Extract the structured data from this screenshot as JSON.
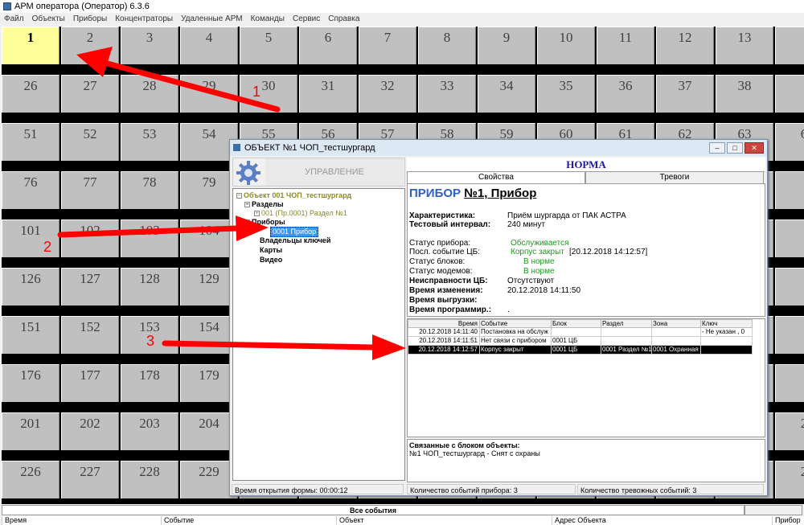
{
  "app": {
    "title": "АРМ оператора (Оператор) 6.3.6"
  },
  "menu": [
    "Файл",
    "Объекты",
    "Приборы",
    "Концентраторы",
    "Удаленные АРМ",
    "Команды",
    "Сервис",
    "Справка"
  ],
  "grid_rows": [
    [
      "1",
      "2",
      "3",
      "4",
      "5",
      "6",
      "7",
      "8",
      "9",
      "10",
      "11",
      "12",
      "13",
      ""
    ],
    [
      "26",
      "27",
      "28",
      "29",
      "30",
      "31",
      "32",
      "33",
      "34",
      "35",
      "36",
      "37",
      "38",
      ""
    ],
    [
      "51",
      "52",
      "53",
      "54",
      "55",
      "56",
      "57",
      "58",
      "59",
      "60",
      "61",
      "62",
      "63",
      "6"
    ],
    [
      "76",
      "77",
      "78",
      "79",
      "",
      "",
      "",
      "",
      "",
      "",
      "",
      "",
      "",
      ""
    ],
    [
      "101",
      "102",
      "103",
      "104",
      "",
      "",
      "",
      "",
      "",
      "",
      "",
      "",
      "",
      ""
    ],
    [
      "126",
      "127",
      "128",
      "129",
      "",
      "",
      "",
      "",
      "",
      "",
      "",
      "",
      "",
      ""
    ],
    [
      "151",
      "152",
      "153",
      "154",
      "",
      "",
      "",
      "",
      "",
      "",
      "",
      "",
      "",
      ""
    ],
    [
      "176",
      "177",
      "178",
      "179",
      "",
      "",
      "",
      "",
      "",
      "",
      "",
      "",
      "",
      ""
    ],
    [
      "201",
      "202",
      "203",
      "204",
      "",
      "",
      "",
      "",
      "",
      "",
      "",
      "",
      "",
      "2"
    ],
    [
      "226",
      "227",
      "228",
      "229",
      "",
      "",
      "",
      "",
      "",
      "",
      "",
      "",
      "",
      "2"
    ]
  ],
  "dialog": {
    "title": "ОБЪЕКТ №1 ЧОП_тестшургард",
    "management_label": "УПРАВЛЕНИЕ",
    "state": "НОРМА",
    "tabs": [
      "Свойства",
      "Тревоги"
    ],
    "tree": {
      "root": "Объект 001 ЧОП_тестшургард",
      "sections": "Разделы",
      "section_item": "001 (Пр.0001) Раздел №1",
      "devices": "Приборы",
      "device_item": "0001 Прибор",
      "key_owners": "Владельцы ключей",
      "maps": "Карты",
      "video": "Видео"
    },
    "device": {
      "prefix": "ПРИБОР",
      "name": "№1, Прибор"
    },
    "props": {
      "characteristic_label": "Характеристика:",
      "characteristic": "Приём шургарда от ПАК АСТРА",
      "test_label": "Тестовый интервал:",
      "test": "240 минут",
      "status_label": "Статус прибора:",
      "status": "Обслуживается",
      "last_label": "Посл. событие ЦБ:",
      "last": "Корпус закрыт",
      "last_time": "[20.12.2018 14:12:57]",
      "blocks_label": "Статус блоков:",
      "blocks": "В норме",
      "modems_label": "Статус модемов:",
      "modems": "В норме",
      "faults_label": "Неисправности ЦБ:",
      "faults": "Отсутствуют",
      "changed_label": "Время изменения:",
      "changed": "20.12.2018 14:11:50",
      "upload_label": "Время выгрузки:",
      "upload": "",
      "prog_label": "Время программир.:",
      "prog": "."
    },
    "events": {
      "columns": [
        "Время",
        "Событие",
        "Блок",
        "Раздел",
        "Зона",
        "Ключ"
      ],
      "rows": [
        [
          "20.12.2018 14:11:40",
          "Постановка на обслуж",
          "",
          "",
          "",
          "- Не указан , 0"
        ],
        [
          "20.12.2018 14:11:51",
          "Нет связи с прибором",
          "0001 ЦБ",
          "",
          "",
          ""
        ],
        [
          "20.12.2018 14:12:57",
          "Корпус закрыт",
          "0001 ЦБ",
          "0001 Раздел №1",
          "0001 Охранная",
          ""
        ]
      ]
    },
    "related": {
      "title": "Связанные с блоком объекты:",
      "text": "№1  ЧОП_тестшургард - Снят с охраны"
    },
    "statusbar": {
      "open_time": "Время открытия формы: 00:00:12",
      "event_count": "Количество событий прибора: 3",
      "alarm_count": "Количество тревожных событий: 3"
    }
  },
  "bottom": {
    "tab": "Все события",
    "columns": [
      "Время",
      "Событие",
      "Объект",
      "Адрес Объекта",
      "Прибор"
    ]
  },
  "annotations": [
    "1",
    "2",
    "3"
  ],
  "colors": {
    "active_tile": "#ffff99",
    "tile": "#c0c0c0",
    "norm": "#1a1aa0",
    "green": "#1c9a1c",
    "arrow": "#ff0000"
  }
}
